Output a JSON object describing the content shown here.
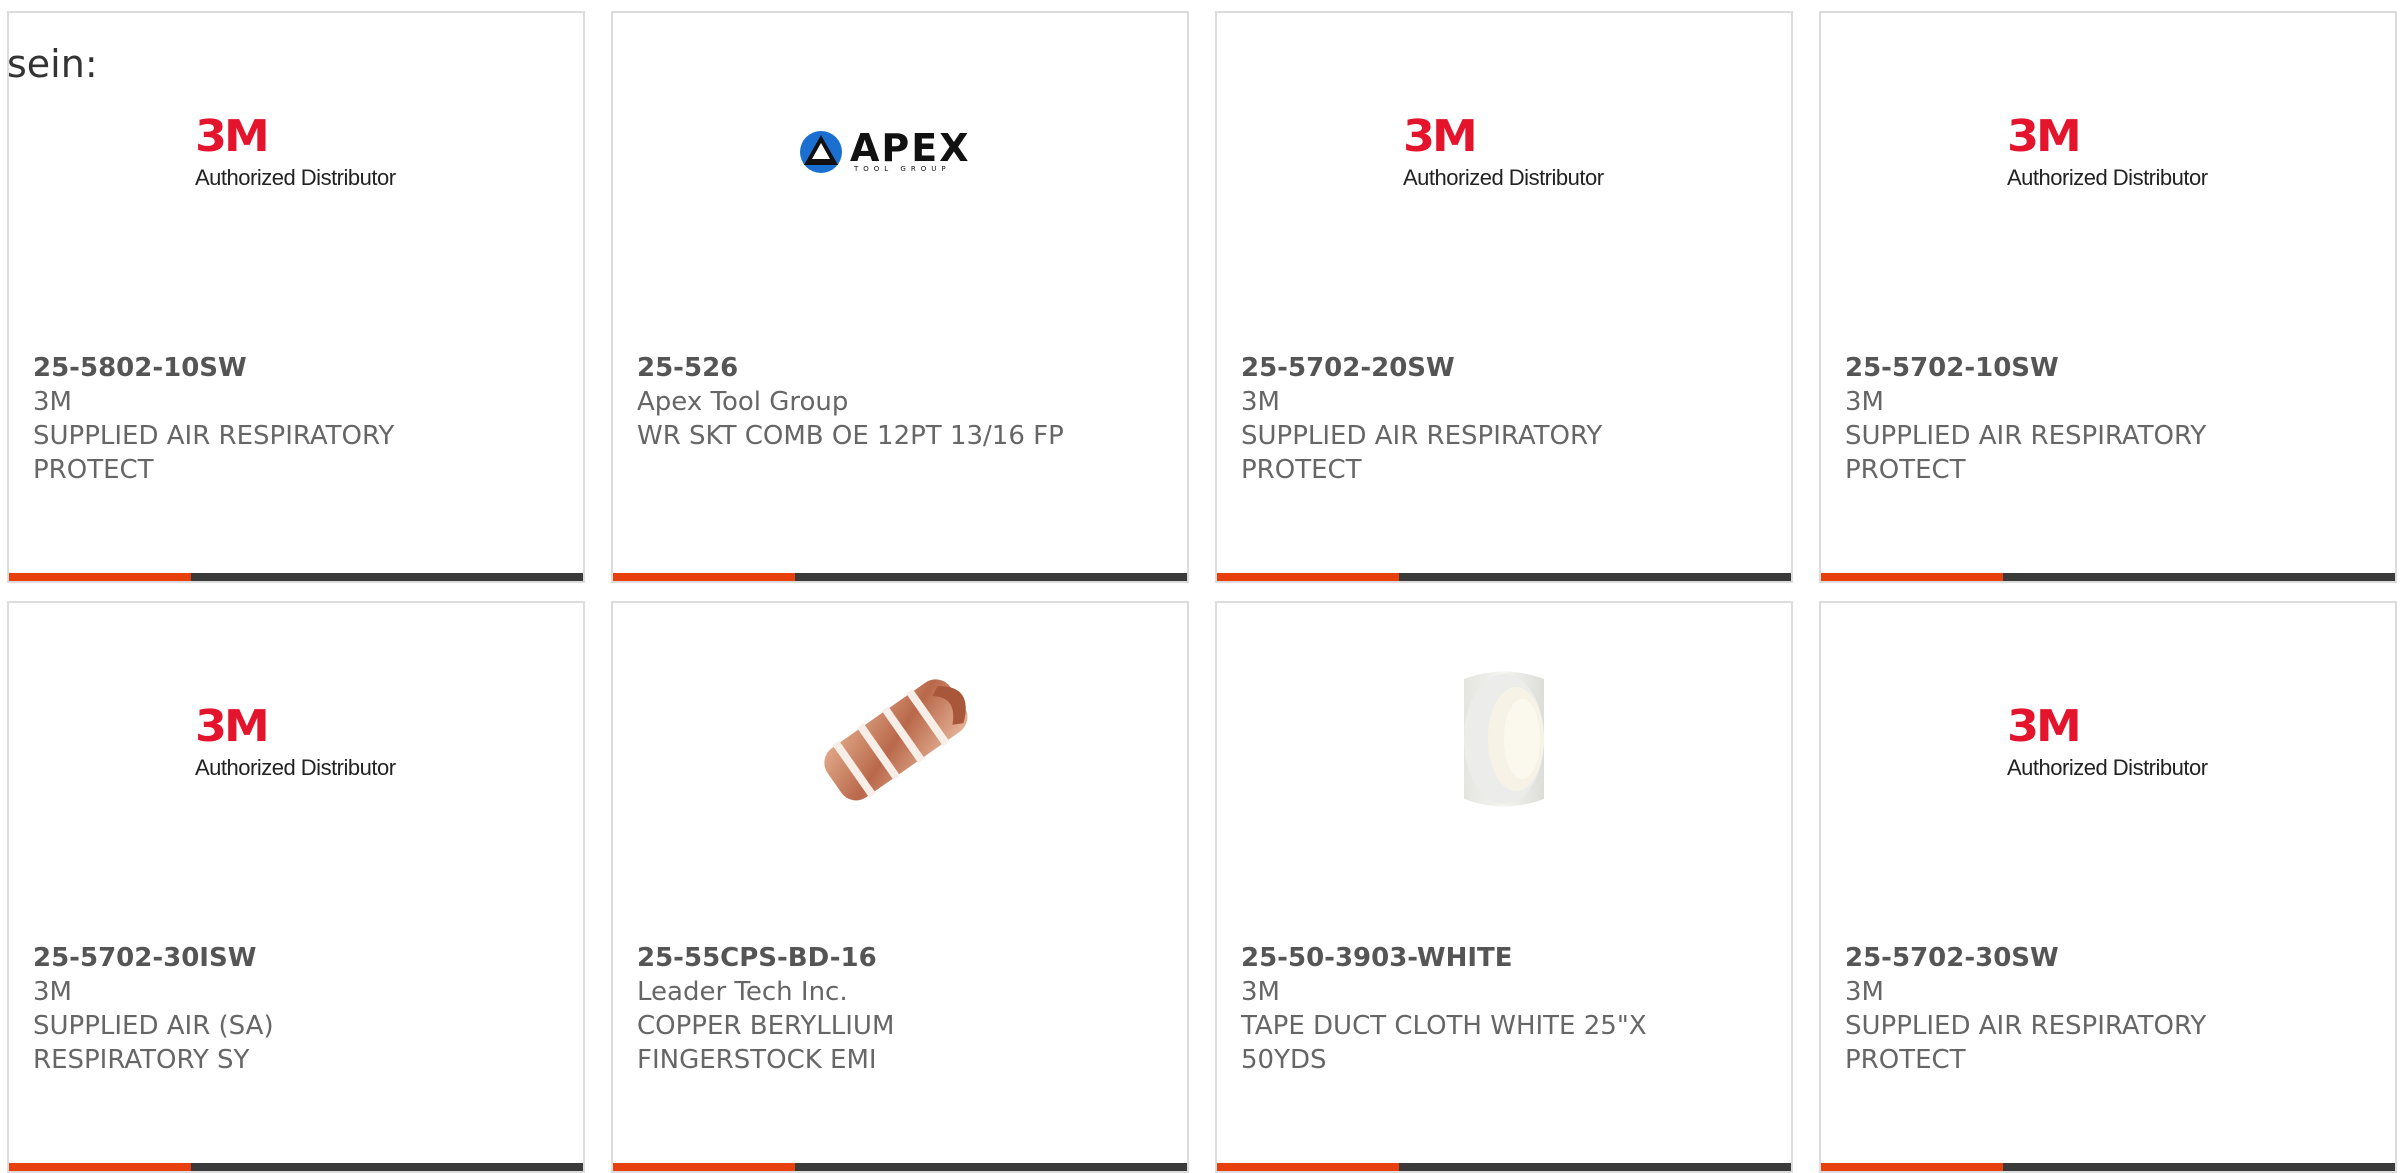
{
  "intro_text": "sein:",
  "colors": {
    "accent": "#e8400c",
    "bar_dark": "#3a3a3a",
    "brand_3m_red": "#e3142c"
  },
  "cards": [
    {
      "part_number": "25-5802-10SW",
      "manufacturer": "3M",
      "description": "SUPPLIED AIR RESPIRATORY PROTECT",
      "image": "3m-authorized-distributor-logo",
      "logo_mark": "3M",
      "logo_sub": "Authorized Distributor"
    },
    {
      "part_number": "25-526",
      "manufacturer": "Apex Tool Group",
      "description": "WR SKT COMB OE 12PT 13/16 FP",
      "image": "apex-tool-group-logo",
      "logo_word": "APEX",
      "logo_tag": "TOOL GROUP"
    },
    {
      "part_number": "25-5702-20SW",
      "manufacturer": "3M",
      "description": "SUPPLIED AIR RESPIRATORY PROTECT",
      "image": "3m-authorized-distributor-logo",
      "logo_mark": "3M",
      "logo_sub": "Authorized Distributor"
    },
    {
      "part_number": "25-5702-10SW",
      "manufacturer": "3M",
      "description": "SUPPLIED AIR RESPIRATORY PROTECT",
      "image": "3m-authorized-distributor-logo",
      "logo_mark": "3M",
      "logo_sub": "Authorized Distributor"
    },
    {
      "part_number": "25-5702-30ISW",
      "manufacturer": "3M",
      "description": "SUPPLIED AIR (SA) RESPIRATORY SY",
      "image": "3m-authorized-distributor-logo",
      "logo_mark": "3M",
      "logo_sub": "Authorized Distributor"
    },
    {
      "part_number": "25-55CPS-BD-16",
      "manufacturer": "Leader Tech Inc.",
      "description": "COPPER BERYLLIUM FINGERSTOCK EMI",
      "image": "copper-fingerstock-photo"
    },
    {
      "part_number": "25-50-3903-WHITE",
      "manufacturer": "3M",
      "description": "TAPE DUCT CLOTH WHITE 25\"X 50YDS",
      "image": "white-tape-roll-photo"
    },
    {
      "part_number": "25-5702-30SW",
      "manufacturer": "3M",
      "description": "SUPPLIED AIR RESPIRATORY PROTECT",
      "image": "3m-authorized-distributor-logo",
      "logo_mark": "3M",
      "logo_sub": "Authorized Distributor"
    }
  ]
}
